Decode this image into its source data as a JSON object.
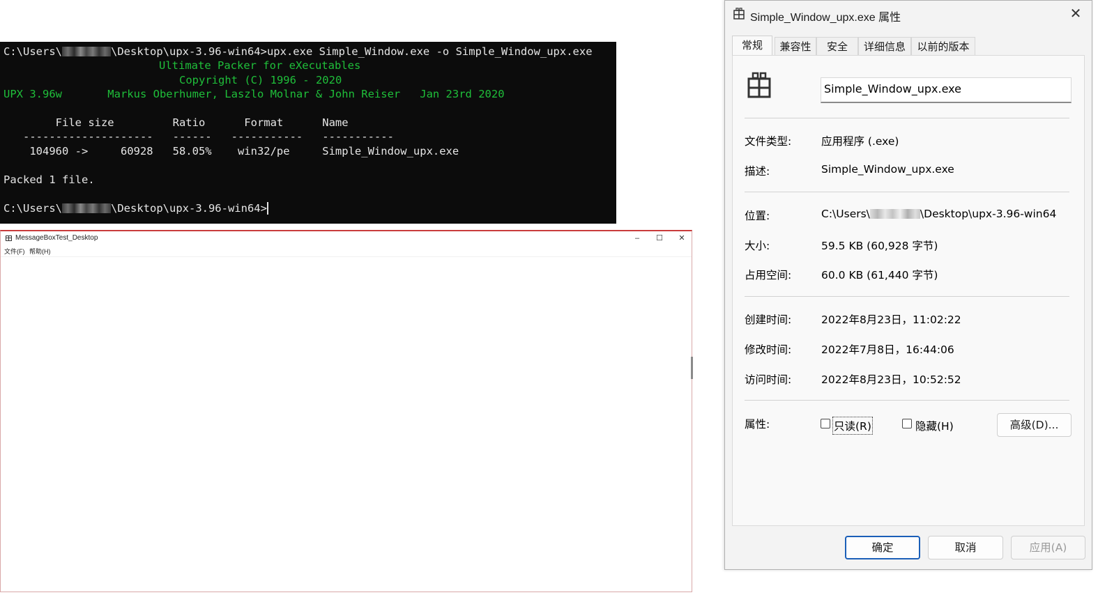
{
  "console": {
    "prompt_prefix": "C:\\Users\\",
    "line1_suffix": "\\Desktop\\upx-3.96-win64>upx.exe Simple_Window.exe -o Simple_Window_upx.exe",
    "banner1": "Ultimate Packer for eXecutables",
    "banner2": "Copyright (C) 1996 - 2020",
    "banner3": "UPX 3.96w       Markus Oberhumer, Laszlo Molnar & John Reiser   Jan 23rd 2020",
    "table_header": "        File size         Ratio      Format      Name",
    "table_rule": "   --------------------   ------   -----------   -----------",
    "table_row": "    104960 ->     60928   58.05%    win32/pe     Simple_Window_upx.exe",
    "packed": "Packed 1 file.",
    "prompt_suffix": "\\Desktop\\upx-3.96-win64>"
  },
  "msgwin": {
    "title": "MessageBoxTest_Desktop",
    "menu": [
      "文件(F)",
      "帮助(H)"
    ],
    "controls": {
      "minimize": "–",
      "maximize": "☐",
      "close": "✕"
    }
  },
  "dialog": {
    "title": "Simple_Window_upx.exe 属性",
    "close": "✕",
    "tabs": [
      "常规",
      "兼容性",
      "安全",
      "详细信息",
      "以前的版本"
    ],
    "filename": "Simple_Window_upx.exe",
    "labels": {
      "type": "文件类型:",
      "desc": "描述:",
      "location": "位置:",
      "size": "大小:",
      "disk": "占用空间:",
      "created": "创建时间:",
      "modified": "修改时间:",
      "accessed": "访问时间:",
      "attrs": "属性:"
    },
    "values": {
      "type": "应用程序 (.exe)",
      "desc": "Simple_Window_upx.exe",
      "location_prefix": "C:\\Users\\",
      "location_suffix": "\\Desktop\\upx-3.96-win64",
      "size": "59.5 KB (60,928 字节)",
      "disk": "60.0 KB (61,440 字节)",
      "created": "2022年8月23日，11:02:22",
      "modified": "2022年7月8日，16:44:06",
      "accessed": "2022年8月23日，10:52:52"
    },
    "readonly": "只读(R)",
    "hidden": "隐藏(H)",
    "advanced": "高级(D)...",
    "ok": "确定",
    "cancel": "取消",
    "apply": "应用(A)"
  }
}
